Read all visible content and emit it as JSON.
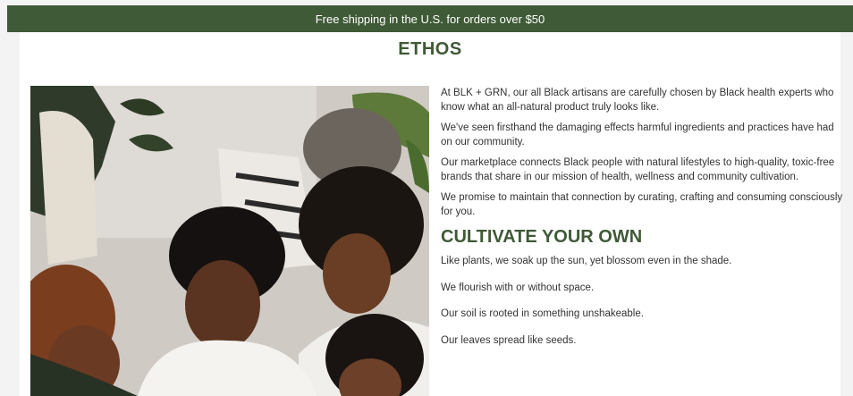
{
  "announcement": {
    "text": "Free shipping in the U.S. for orders over $50"
  },
  "ethos": {
    "title": "ETHOS"
  },
  "about": {
    "paragraphs": [
      "At BLK + GRN, our all Black artisans are carefully chosen by Black health experts who know what an all-natural product truly looks like.",
      "We've seen firsthand the damaging effects harmful ingredients and practices have had on our community.",
      "Our marketplace connects Black people with natural lifestyles to high-quality, toxic-free brands that share in our mission of health, wellness and community cultivation.",
      "We promise to maintain that connection by curating, crafting and consuming consciously for you."
    ]
  },
  "cultivate": {
    "title": "CULTIVATE YOUR OWN",
    "lines": [
      "Like plants, we soak up the sun, yet blossom even in the shade.",
      "We flourish with or without space.",
      "Our soil is rooted in something unshakeable.",
      "Our leaves spread like seeds."
    ]
  },
  "colors": {
    "brand_green": "#3f5a36",
    "body_text": "#333333"
  }
}
